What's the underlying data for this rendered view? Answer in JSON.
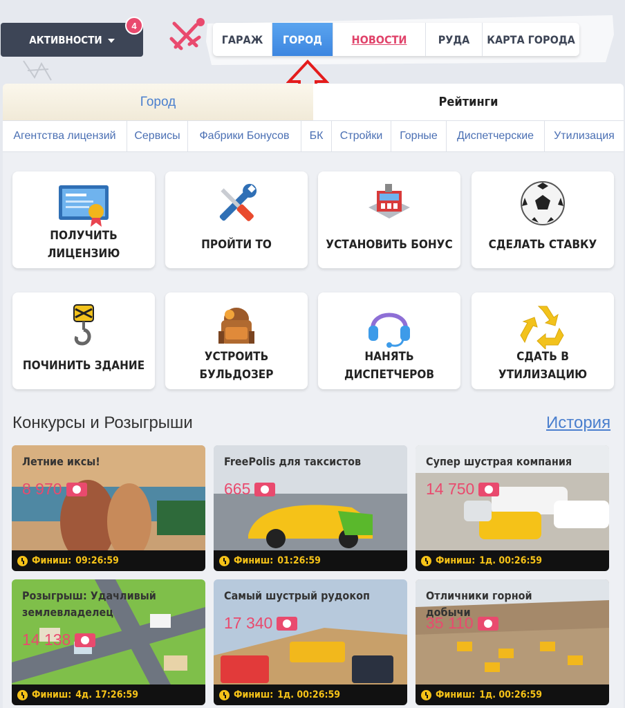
{
  "topbar": {
    "activities_label": "АКТИВНОСТИ",
    "activities_badge": "4",
    "nav": [
      {
        "label": "ГАРАЖ"
      },
      {
        "label": "ГОРОД"
      },
      {
        "label": "НОВОСТИ"
      },
      {
        "label": "РУДА"
      },
      {
        "label": "КАРТА ГОРОДА"
      }
    ]
  },
  "tabs": {
    "city": "Город",
    "ratings": "Рейтинги"
  },
  "subnav": [
    "Агентства лицензий",
    "Сервисы",
    "Фабрики Бонусов",
    "БК",
    "Стройки",
    "Горные",
    "Диспетчерские",
    "Утилизация"
  ],
  "actions": [
    {
      "label": "ПОЛУЧИТЬ ЛИЦЕНЗИЮ",
      "icon": "license-certificate-icon"
    },
    {
      "label": "ПРОЙТИ ТО",
      "icon": "wrench-screwdriver-icon"
    },
    {
      "label": "УСТАНОВИТЬ БОНУС",
      "icon": "factory-building-icon"
    },
    {
      "label": "СДЕЛАТЬ СТАВКУ",
      "icon": "soccer-ball-icon"
    },
    {
      "label": "ПОЧИНИТЬ ЗДАНИЕ",
      "icon": "crane-hook-icon"
    },
    {
      "label": "УСТРОИТЬ БУЛЬДОЗЕР",
      "icon": "backpack-icon"
    },
    {
      "label": "НАНЯТЬ ДИСПЕТЧЕРОВ",
      "icon": "headset-icon"
    },
    {
      "label": "СДАТЬ В УТИЛИЗАЦИЮ",
      "icon": "recycle-icon"
    }
  ],
  "contests": {
    "section_title": "Конкурсы и Розыгрыши",
    "history_link": "История",
    "finish_label": "Финиш:",
    "items": [
      {
        "title": "Летние иксы!",
        "prize": "8 970",
        "finish": "09:26:59"
      },
      {
        "title": "FreePolis для таксистов",
        "prize": "665",
        "finish": "01:26:59"
      },
      {
        "title": "Супер шустрая компания",
        "prize": "14 750",
        "finish": "1д. 00:26:59"
      },
      {
        "title": "Розыгрыш: Удачливый землевладелец",
        "prize": "14 138",
        "finish": "4д. 17:26:59"
      },
      {
        "title": "Самый шустрый рудокоп",
        "prize": "17 340",
        "finish": "1д. 00:26:59"
      },
      {
        "title": "Отличники горной добычи",
        "prize": "35 110",
        "finish": "1д. 00:26:59"
      }
    ]
  },
  "colors": {
    "accent_blue": "#3d86e0",
    "accent_pink": "#e94a6e",
    "finish_yellow": "#f5c218",
    "dark_button": "#3d4556"
  }
}
